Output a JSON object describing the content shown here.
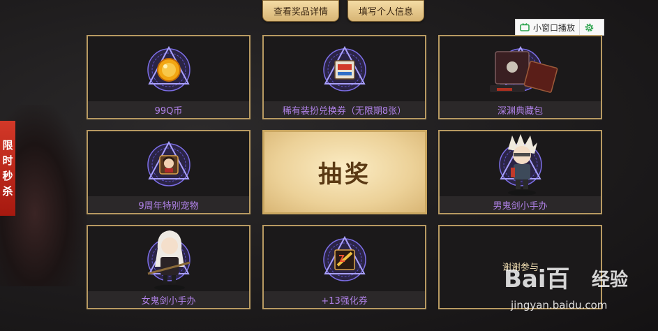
{
  "header": {
    "view_prize_details_label": "查看奖品详情",
    "fill_personal_info_label": "填写个人信息"
  },
  "mini_player": {
    "label": "小窗口播放",
    "tv_icon": "tv-icon",
    "settings_icon": "gear-icon"
  },
  "side_tag": {
    "chars": [
      "限",
      "时",
      "秒",
      "杀"
    ]
  },
  "prizes": [
    {
      "label": "99Q币",
      "icon": "q-coin-icon"
    },
    {
      "label": "稀有装扮兑换券（无限期8张）",
      "icon": "coupon-icon"
    },
    {
      "label": "深渊典藏包",
      "icon": "collection-box-icon"
    },
    {
      "label": "9周年特别宠物",
      "icon": "pet-icon"
    },
    {
      "label": "男鬼剑小手办",
      "icon": "male-slayer-figure-icon"
    },
    {
      "label": "女鬼剑小手办",
      "icon": "female-slayer-figure-icon"
    },
    {
      "label": "+13强化券",
      "icon": "enhance-ticket-icon"
    }
  ],
  "draw_button": {
    "label": "抽奖"
  },
  "thanks_cell": {
    "label": "谢谢参与"
  },
  "watermark": {
    "logo": "Bai百",
    "product": "经验",
    "url": "jingyan.baidu.com"
  },
  "colors": {
    "frame_gold": "#b89a62",
    "label_purple": "#b082e8",
    "side_tag_red": "#c0281a"
  }
}
